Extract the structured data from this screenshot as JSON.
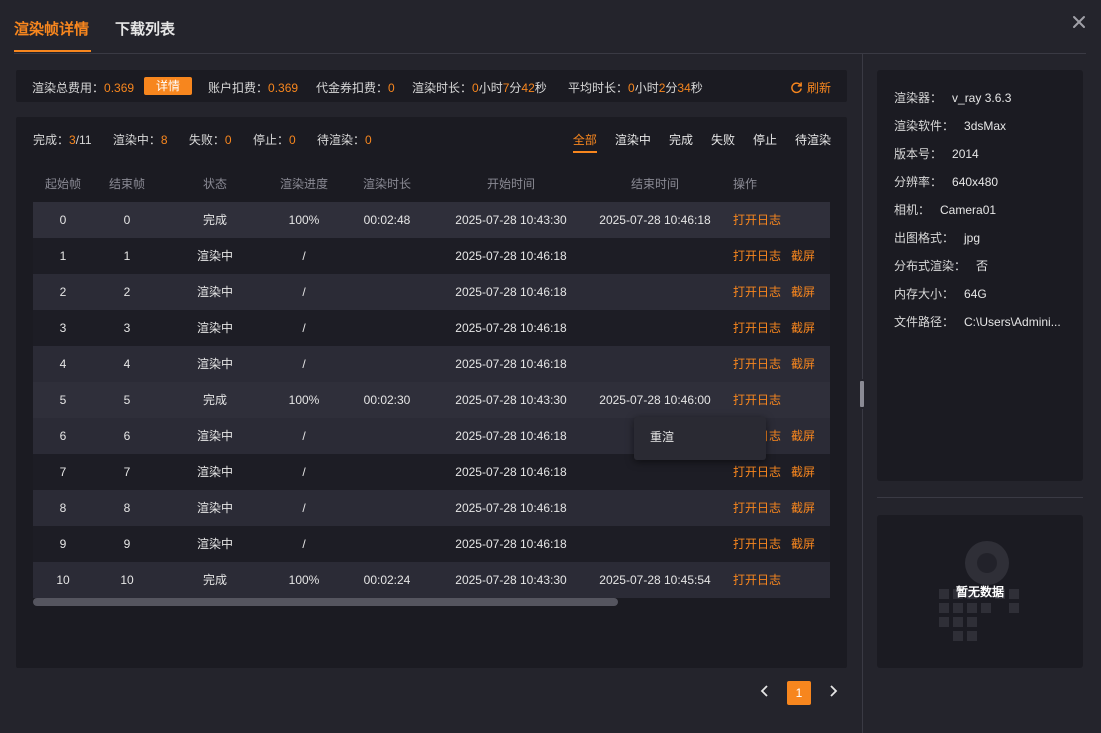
{
  "tabs": {
    "frame_details": "渲染帧详情",
    "download_list": "下载列表"
  },
  "summary": {
    "total_cost_label": "渲染总费用：",
    "total_cost_value": "0.369",
    "detail_button": "详情",
    "account_label": "账户扣费：",
    "account_value": "0.369",
    "voucher_label": "代金券扣费：",
    "voucher_value": "0",
    "render_time_label": "渲染时长：",
    "render_time": {
      "h": "0",
      "h_unit": "小时",
      "m": "7",
      "m_unit": "分",
      "s": "42",
      "s_unit": "秒"
    },
    "avg_time_label": "平均时长：",
    "avg_time": {
      "h": "0",
      "h_unit": "小时",
      "m": "2",
      "m_unit": "分",
      "s": "34",
      "s_unit": "秒"
    },
    "refresh": "刷新"
  },
  "counts": {
    "done_label": "完成：",
    "done": "3",
    "done_total": "/11",
    "rendering_label": "渲染中：",
    "rendering": "8",
    "failed_label": "失败：",
    "failed": "0",
    "stopped_label": "停止：",
    "stopped": "0",
    "pending_label": "待渲染：",
    "pending": "0"
  },
  "filters": [
    "全部",
    "渲染中",
    "完成",
    "失败",
    "停止",
    "待渲染"
  ],
  "table": {
    "headers": [
      "起始帧",
      "结束帧",
      "状态",
      "渲染进度",
      "渲染时长",
      "开始时间",
      "结束时间",
      "操作"
    ],
    "open_log": "打开日志",
    "screenshot": "截屏",
    "rows": [
      {
        "start": "0",
        "end": "0",
        "status": "完成",
        "progress": "100%",
        "duration": "00:02:48",
        "start_time": "2025-07-28 10:43:30",
        "end_time": "2025-07-28 10:46:18",
        "shot": ""
      },
      {
        "start": "1",
        "end": "1",
        "status": "渲染中",
        "progress": "/",
        "duration": "",
        "start_time": "2025-07-28 10:46:18",
        "end_time": "",
        "shot": "截屏"
      },
      {
        "start": "2",
        "end": "2",
        "status": "渲染中",
        "progress": "/",
        "duration": "",
        "start_time": "2025-07-28 10:46:18",
        "end_time": "",
        "shot": "截屏"
      },
      {
        "start": "3",
        "end": "3",
        "status": "渲染中",
        "progress": "/",
        "duration": "",
        "start_time": "2025-07-28 10:46:18",
        "end_time": "",
        "shot": "截屏"
      },
      {
        "start": "4",
        "end": "4",
        "status": "渲染中",
        "progress": "/",
        "duration": "",
        "start_time": "2025-07-28 10:46:18",
        "end_time": "",
        "shot": "截屏"
      },
      {
        "start": "5",
        "end": "5",
        "status": "完成",
        "progress": "100%",
        "duration": "00:02:30",
        "start_time": "2025-07-28 10:43:30",
        "end_time": "2025-07-28 10:46:00",
        "shot": ""
      },
      {
        "start": "6",
        "end": "6",
        "status": "渲染中",
        "progress": "/",
        "duration": "",
        "start_time": "2025-07-28 10:46:18",
        "end_time": "",
        "shot": "截屏"
      },
      {
        "start": "7",
        "end": "7",
        "status": "渲染中",
        "progress": "/",
        "duration": "",
        "start_time": "2025-07-28 10:46:18",
        "end_time": "",
        "shot": "截屏"
      },
      {
        "start": "8",
        "end": "8",
        "status": "渲染中",
        "progress": "/",
        "duration": "",
        "start_time": "2025-07-28 10:46:18",
        "end_time": "",
        "shot": "截屏"
      },
      {
        "start": "9",
        "end": "9",
        "status": "渲染中",
        "progress": "/",
        "duration": "",
        "start_time": "2025-07-28 10:46:18",
        "end_time": "",
        "shot": "截屏"
      },
      {
        "start": "10",
        "end": "10",
        "status": "完成",
        "progress": "100%",
        "duration": "00:02:24",
        "start_time": "2025-07-28 10:43:30",
        "end_time": "2025-07-28 10:45:54",
        "shot": ""
      }
    ]
  },
  "popover": {
    "rerender": "重渲"
  },
  "pagination": {
    "current": "1",
    "prev_icon": "chevron-left-icon",
    "next_icon": "chevron-right-icon"
  },
  "info": [
    {
      "k": "渲染器：",
      "v": "v_ray 3.6.3"
    },
    {
      "k": "渲染软件：",
      "v": "3dsMax"
    },
    {
      "k": "版本号：",
      "v": "2014"
    },
    {
      "k": "分辨率：",
      "v": "640x480"
    },
    {
      "k": "相机：",
      "v": "Camera01"
    },
    {
      "k": "出图格式：",
      "v": "jpg"
    },
    {
      "k": "分布式渲染：",
      "v": "否"
    },
    {
      "k": "内存大小：",
      "v": "64G"
    },
    {
      "k": "文件路径：",
      "v": "C:\\Users\\Admini..."
    }
  ],
  "preview": {
    "no_data": "暂无数据"
  },
  "colors": {
    "accent": "#f7861e",
    "background": "#24242c",
    "panel": "#1b1b22"
  }
}
